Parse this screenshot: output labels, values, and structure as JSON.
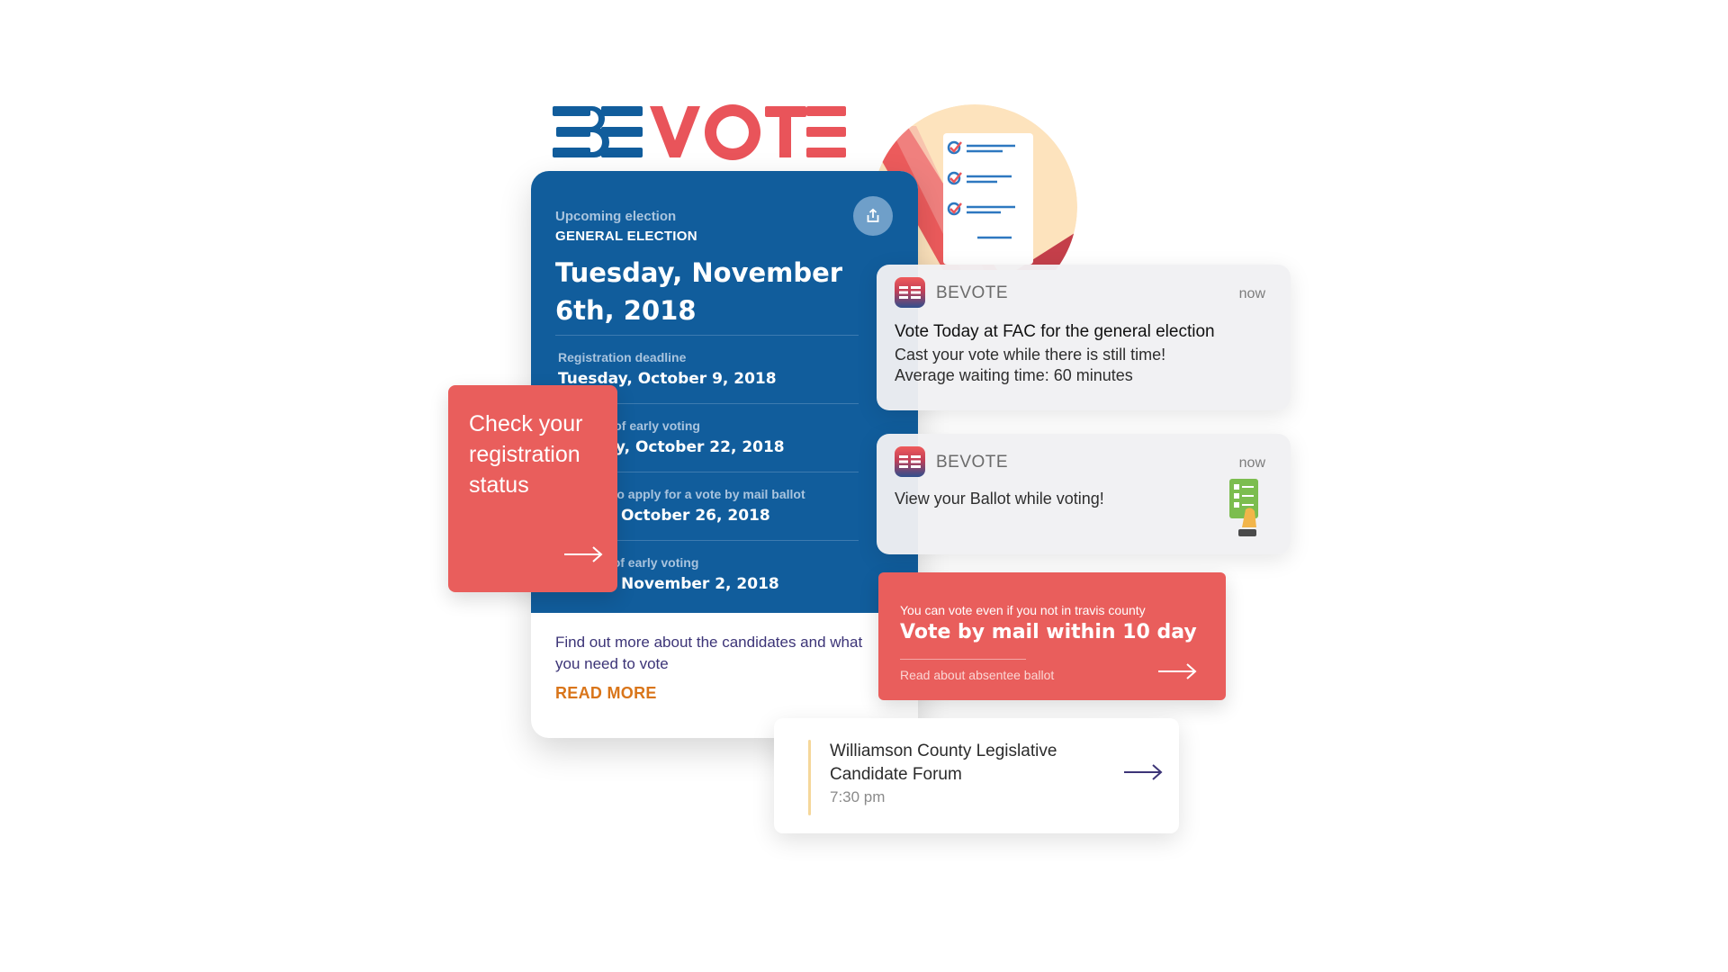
{
  "brand": {
    "logo_text": "BEVOTE"
  },
  "election_card": {
    "eyebrow": "Upcoming election",
    "election_type": "GENERAL ELECTION",
    "date": "Tuesday, November 6th, 2018",
    "deadlines": [
      {
        "label": "Registration deadline",
        "value": "Tuesday, October 9, 2018"
      },
      {
        "label": "First day of early voting",
        "value": "Monday, October 22, 2018"
      },
      {
        "label": "Last day to apply for a vote by mail ballot",
        "value": "Friday, October 26, 2018"
      },
      {
        "label": "Last day of early voting",
        "value": "Friday, November 2, 2018"
      }
    ],
    "info_text": "Find out more about the candidates and what you need to vote",
    "read_more": "READ MORE"
  },
  "registration_card": {
    "text": "Check your registration status"
  },
  "notifications": [
    {
      "app_name": "BEVOTE",
      "time": "now",
      "title": "Vote Today at FAC for the general election",
      "lines": [
        "Cast your vote while there is still time!",
        "Average waiting time: 60 minutes"
      ]
    },
    {
      "app_name": "BEVOTE",
      "time": "now",
      "title": "",
      "lines": [
        "View your Ballot while voting!"
      ]
    }
  ],
  "mail_card": {
    "subtitle": "You can vote even if you not in travis county",
    "title": "Vote by mail within 10 day",
    "link": "Read about absentee ballot"
  },
  "event_card": {
    "title": "Williamson County Legislative Candidate Forum",
    "time": "7:30 pm"
  },
  "colors": {
    "brand_blue": "#115d9c",
    "brand_red": "#e95e5c",
    "read_more_orange": "#d9751a",
    "text_purple": "#3c3477"
  }
}
